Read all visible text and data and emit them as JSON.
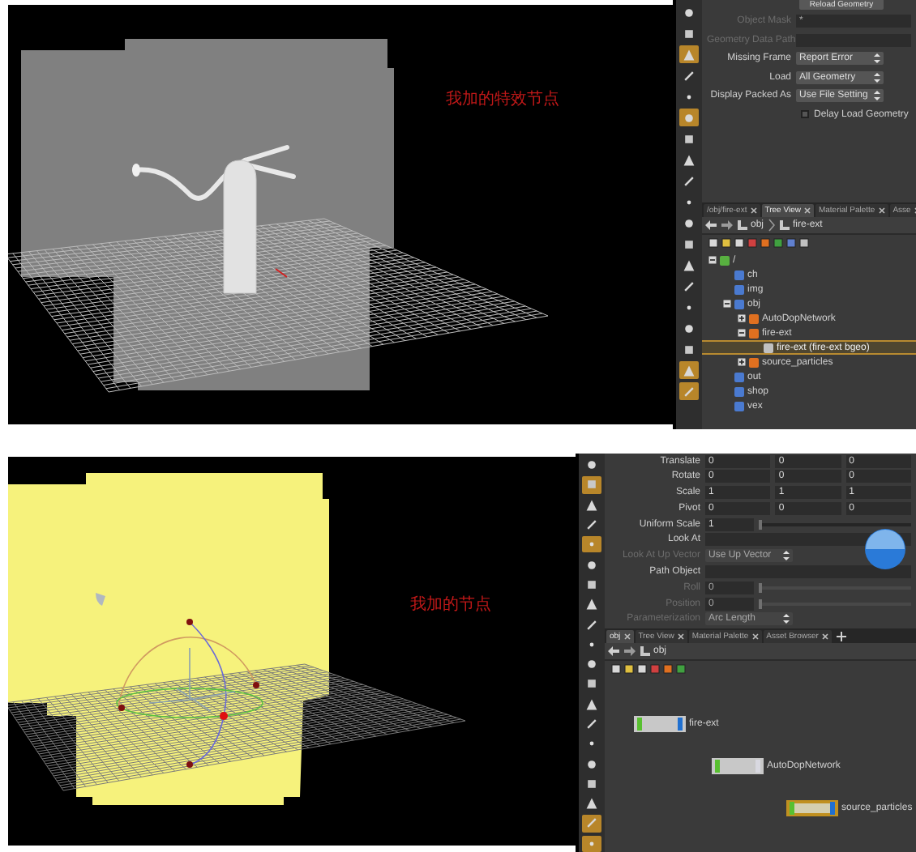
{
  "top_panel": {
    "viewport": {
      "annotation": "我加的特效节点"
    },
    "toolbar_tools": [
      {
        "selected": false
      },
      {
        "selected": false
      },
      {
        "selected": true
      },
      {
        "selected": false
      },
      {
        "selected": false
      },
      {
        "selected": true
      },
      {
        "selected": false
      },
      {
        "selected": false
      },
      {
        "selected": false
      },
      {
        "selected": false
      },
      {
        "selected": false
      },
      {
        "selected": false
      },
      {
        "selected": false
      },
      {
        "selected": false
      },
      {
        "selected": false
      },
      {
        "selected": false
      },
      {
        "selected": false
      },
      {
        "selected": true
      },
      {
        "selected": true
      }
    ],
    "reload_button": "Reload Geometry",
    "params": [
      {
        "kind": "field",
        "label": "Object Mask",
        "value": "*",
        "disabled": true
      },
      {
        "kind": "field",
        "label": "Geometry Data Path",
        "disabled": true
      },
      {
        "kind": "menu",
        "label": "Missing Frame",
        "value": "Report Error",
        "disabled": false
      },
      {
        "kind": "menu",
        "label": "Load",
        "value": "All Geometry",
        "disabled": false
      },
      {
        "kind": "menu",
        "label": "Display Packed As",
        "value": "Use File Setting",
        "disabled": false
      }
    ],
    "checkbox": {
      "label": "Delay Load Geometry",
      "checked": false
    },
    "tabs": [
      {
        "label": "/obj/fire-ext",
        "selected": false
      },
      {
        "label": "Tree View",
        "selected": true
      },
      {
        "label": "Material Palette",
        "selected": false
      },
      {
        "label": "Asse",
        "selected": false
      }
    ],
    "path": [
      "obj",
      "fire-ext"
    ],
    "tree": [
      {
        "label": "/",
        "expanded": true,
        "selected": false,
        "children": [
          {
            "label": "ch",
            "selected": false
          },
          {
            "label": "img",
            "selected": false
          },
          {
            "label": "obj",
            "expanded": true,
            "selected": false,
            "children": [
              {
                "label": "AutoDopNetwork",
                "expanded": false,
                "selected": false
              },
              {
                "label": "fire-ext",
                "expanded": true,
                "selected": false,
                "children": [
                  {
                    "label": "fire-ext (fire-ext bgeo)",
                    "selected": true
                  }
                ]
              },
              {
                "label": "source_particles",
                "expanded": false,
                "selected": false
              }
            ]
          },
          {
            "label": "out",
            "selected": false
          },
          {
            "label": "shop",
            "selected": false
          },
          {
            "label": "vex",
            "selected": false
          }
        ]
      }
    ]
  },
  "bottom_panel": {
    "viewport": {
      "annotation": "我加的节点"
    },
    "toolbar_tools": [
      {
        "selected": false
      },
      {
        "selected": true
      },
      {
        "selected": false
      },
      {
        "selected": false
      },
      {
        "selected": true
      },
      {
        "selected": false
      },
      {
        "selected": false
      },
      {
        "selected": false
      },
      {
        "selected": false
      },
      {
        "selected": false
      },
      {
        "selected": false
      },
      {
        "selected": false
      },
      {
        "selected": false
      },
      {
        "selected": false
      },
      {
        "selected": false
      },
      {
        "selected": false
      },
      {
        "selected": false
      },
      {
        "selected": false
      },
      {
        "selected": true
      },
      {
        "selected": true
      }
    ],
    "params": [
      {
        "kind": "vector",
        "label": "Translate",
        "values": [
          "0",
          "0",
          "0"
        ],
        "disabled": false
      },
      {
        "kind": "vector",
        "label": "Rotate",
        "values": [
          "0",
          "0",
          "0"
        ],
        "disabled": false
      },
      {
        "kind": "vector",
        "label": "Scale",
        "values": [
          "1",
          "1",
          "1"
        ],
        "disabled": false
      },
      {
        "kind": "vector",
        "label": "Pivot",
        "values": [
          "0",
          "0",
          "0"
        ],
        "disabled": false
      },
      {
        "kind": "slider",
        "label": "Uniform Scale",
        "value": "1",
        "level": 0,
        "disabled": false
      },
      {
        "kind": "field",
        "label": "Look At",
        "disabled": false
      },
      {
        "kind": "menu",
        "label": "Look At Up Vector",
        "value": "Use Up Vector",
        "disabled": true
      },
      {
        "kind": "field",
        "label": "Path Object",
        "disabled": false
      },
      {
        "kind": "slider",
        "label": "Roll",
        "value": "0",
        "level": 0,
        "disabled": true
      },
      {
        "kind": "slider",
        "label": "Position",
        "value": "0",
        "level": 0,
        "disabled": true
      },
      {
        "kind": "menu",
        "label": "Parameterization",
        "value": "Arc Length",
        "disabled": true
      }
    ],
    "tabs": [
      {
        "label": "obj",
        "selected": true
      },
      {
        "label": "Tree View",
        "selected": false
      },
      {
        "label": "Material Palette",
        "selected": false
      },
      {
        "label": "Asset Browser",
        "selected": false
      }
    ],
    "path": [
      "obj"
    ],
    "nodes": [
      {
        "label": "fire-ext",
        "display_flag": true,
        "selected": false
      },
      {
        "label": "AutoDopNetwork",
        "display_flag": false,
        "selected": false
      },
      {
        "label": "source_particles",
        "display_flag": true,
        "selected": true
      }
    ]
  }
}
